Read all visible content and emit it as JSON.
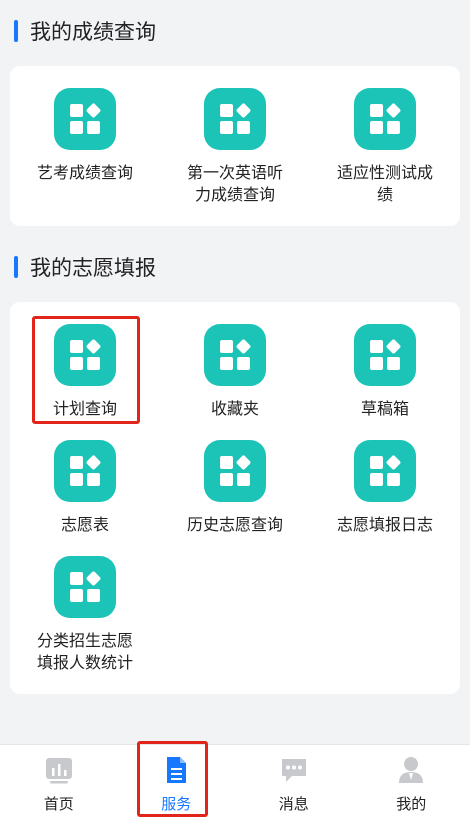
{
  "sections": [
    {
      "title": "我的成绩查询",
      "items": [
        {
          "label": "艺考成绩查询"
        },
        {
          "label": "第一次英语听力成绩查询"
        },
        {
          "label": "适应性测试成绩"
        }
      ]
    },
    {
      "title": "我的志愿填报",
      "items": [
        {
          "label": "计划查询",
          "highlighted": true
        },
        {
          "label": "收藏夹"
        },
        {
          "label": "草稿箱"
        },
        {
          "label": "志愿表"
        },
        {
          "label": "历史志愿查询"
        },
        {
          "label": "志愿填报日志"
        },
        {
          "label": "分类招生志愿填报人数统计"
        }
      ]
    }
  ],
  "tabbar": {
    "items": [
      {
        "label": "首页",
        "icon": "home-icon",
        "active": false
      },
      {
        "label": "服务",
        "icon": "document-icon",
        "active": true,
        "highlighted": true
      },
      {
        "label": "消息",
        "icon": "message-icon",
        "active": false
      },
      {
        "label": "我的",
        "icon": "user-icon",
        "active": false
      }
    ]
  },
  "colors": {
    "accent": "#1677ff",
    "icon_bg": "#1cc4b8",
    "highlight": "#e1251b",
    "inactive_tab": "#c7c9cc"
  }
}
